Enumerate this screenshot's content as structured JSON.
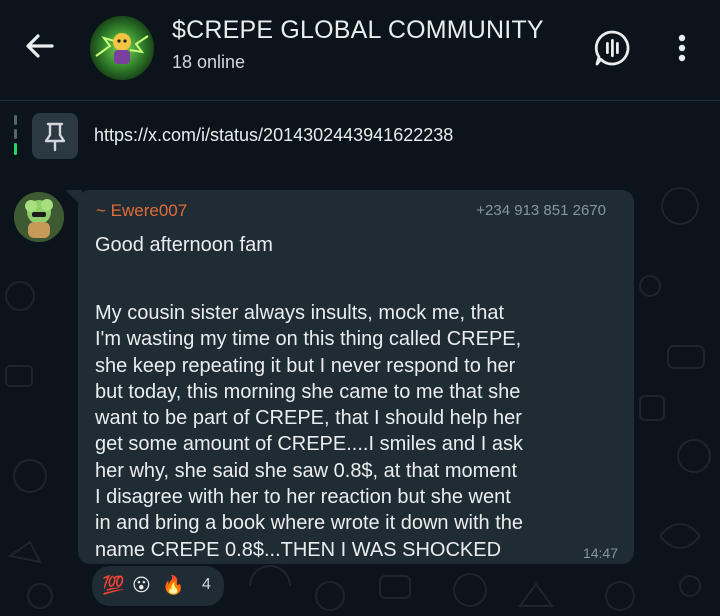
{
  "header": {
    "title": "$CREPE GLOBAL COMMUNITY",
    "subtitle": "18 online",
    "back_icon": "arrow-left-icon",
    "voice_icon": "voice-chat-icon",
    "menu_icon": "more-vertical-icon"
  },
  "pinned": {
    "icon": "pin-icon",
    "text": "https://x.com/i/status/2014302443941622238"
  },
  "message": {
    "sender": "~ Ewere007",
    "phone": "+234 913 851 2670",
    "greeting": "Good afternoon fam",
    "body": "My cousin sister always insults, mock me, that\nI'm wasting my time on this thing called CREPE,\nshe keep repeating it but I never respond to her\nbut today, this morning she came to me that she\nwant to be part of CREPE, that I should help her\nget some amount of CREPE....I smiles and I ask\nher why, she  said she saw 0.8$, at that moment\nI disagree with her to her reaction but she went\nin and bring a book where wrote it down with the\nname CREPE 0.8$...THEN I WAS SHOCKED",
    "time": "14:47"
  },
  "reactions": {
    "emojis": [
      "💯",
      "😮",
      "🔥"
    ],
    "count": "4"
  },
  "colors": {
    "background": "#0b141a",
    "bubble": "#1f2c33",
    "sender_name": "#e26b3a",
    "secondary_text": "#8696a0",
    "pin_bar_accent": "#25d366"
  }
}
